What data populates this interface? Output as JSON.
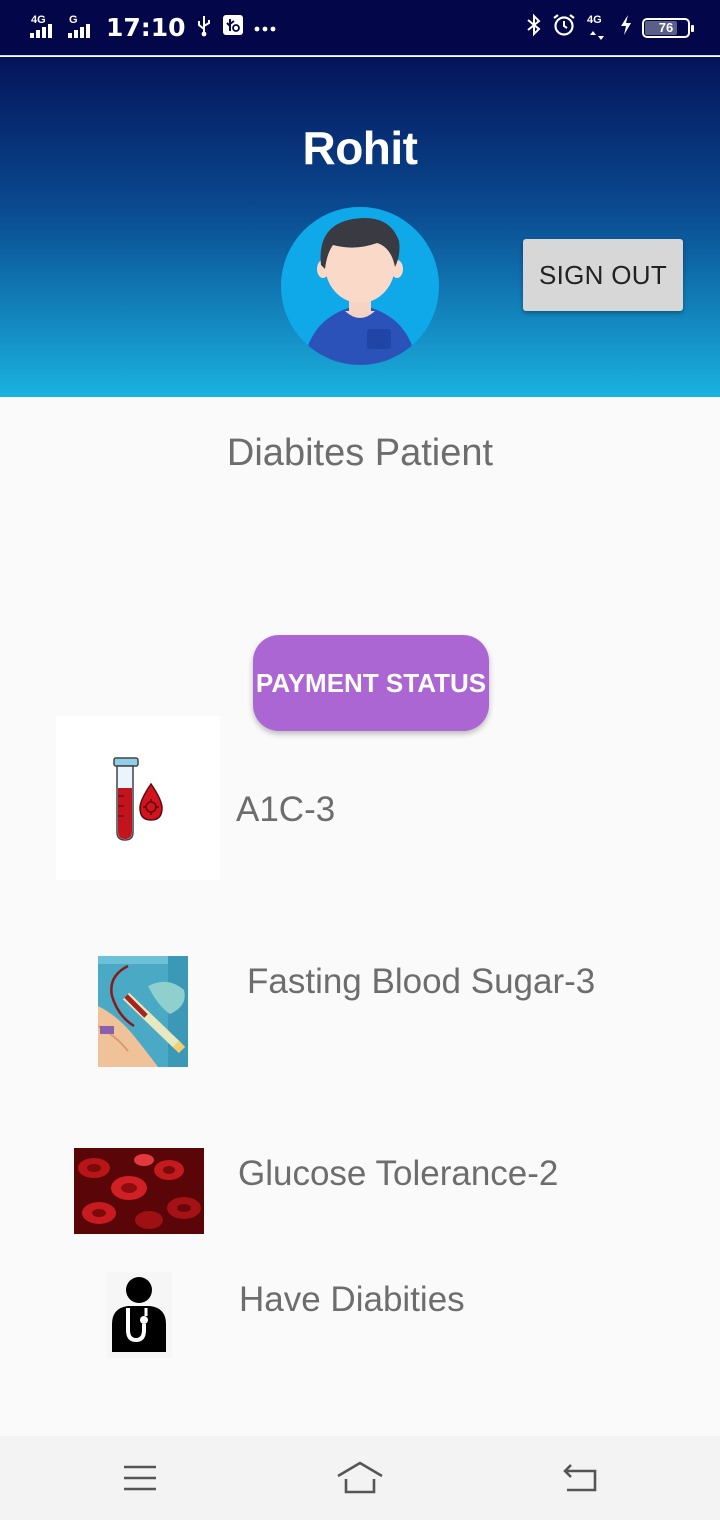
{
  "status_bar": {
    "network_1": "4G",
    "network_2": "G",
    "time": "17:10",
    "network_3": "4G",
    "battery": "76",
    "battery_level_percent": 76
  },
  "header": {
    "user_name": "Rohit",
    "sign_out_label": "SIGN OUT",
    "colors": {
      "top": "#04135a",
      "bottom": "#1ab2e0"
    }
  },
  "role_text": "Diabites Patient",
  "payment_button_label": "PAYMENT STATUS",
  "payment_button_color": "#ac66d4",
  "items": [
    {
      "label": "A1C-3",
      "icon": "test-tube-blood-icon"
    },
    {
      "label": "Fasting Blood Sugar-3",
      "icon": "blood-draw-image"
    },
    {
      "label": "Glucose Tolerance-2",
      "icon": "blood-cells-image"
    },
    {
      "label": "Have Diabities",
      "icon": "doctor-icon"
    }
  ],
  "nav": {
    "menu": "menu-icon",
    "home": "home-icon",
    "back": "back-icon"
  }
}
